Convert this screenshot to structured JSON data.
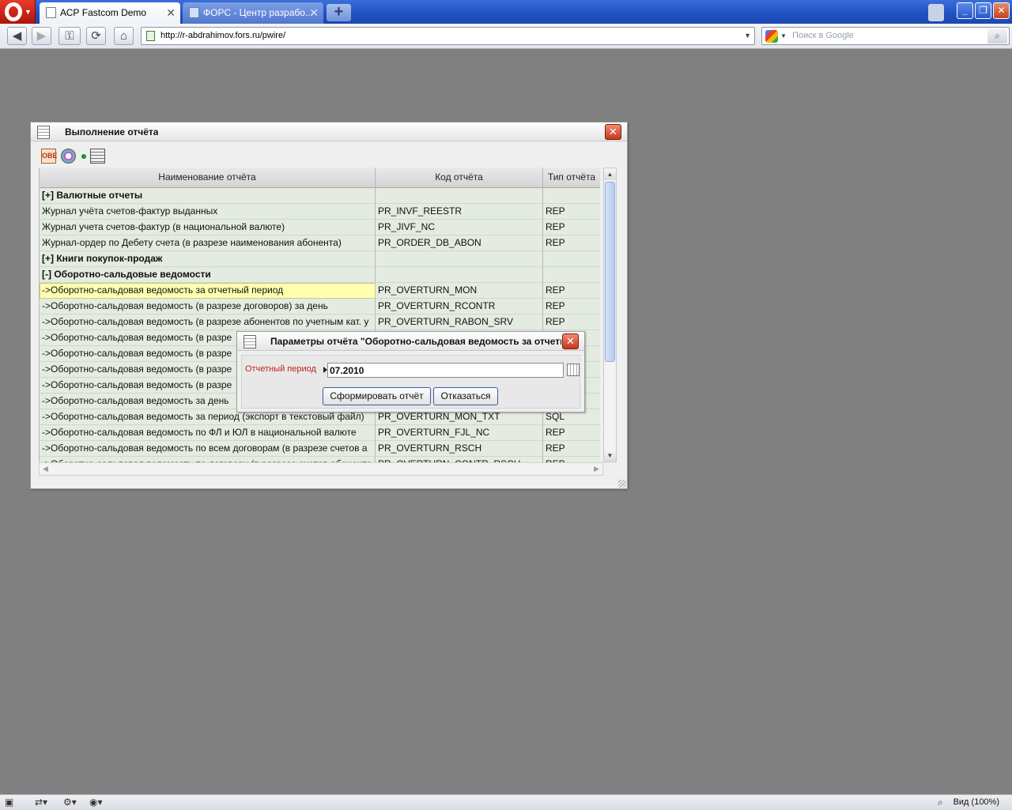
{
  "browser": {
    "tabs": [
      {
        "title": "АСР Fastcom Demo",
        "active": true
      },
      {
        "title": "ФОРС - Центр разрабо...",
        "active": false
      }
    ],
    "new_tab_label": "+",
    "close_glyph": "✕",
    "url": "http://r-abdrahimov.fors.ru/pwire/",
    "search_placeholder": "Поиск в Google",
    "status": {
      "zoom": "Вид (100%)"
    }
  },
  "report_window": {
    "title": "Выполнение отчёта",
    "toolbar": {
      "obe_label": "OBE"
    },
    "columns": [
      "Наименование отчёта",
      "Код отчёта",
      "Тип отчёта"
    ],
    "rows": [
      {
        "name": "[+] Валютные отчеты",
        "code": "",
        "type": "",
        "group": true
      },
      {
        "name": "Журнал учёта счетов-фактур выданных",
        "code": "PR_INVF_REESTR",
        "type": "REP"
      },
      {
        "name": "Журнал учета счетов-фактур (в национальной валюте)",
        "code": "PR_JIVF_NC",
        "type": "REP"
      },
      {
        "name": "Журнал-ордер по Дебету счета (в разрезе наименования абонента)",
        "code": "PR_ORDER_DB_ABON",
        "type": "REP"
      },
      {
        "name": "[+] Книги покупок-продаж",
        "code": "",
        "type": "",
        "group": true
      },
      {
        "name": "[-] Оборотно-сальдовые ведомости",
        "code": "",
        "type": "",
        "group": true
      },
      {
        "name": "->Оборотно-сальдовая ведомость за отчетный период",
        "code": "PR_OVERTURN_MON",
        "type": "REP",
        "selected": true
      },
      {
        "name": "->Оборотно-сальдовая ведомость (в разрезе договоров) за день",
        "code": "PR_OVERTURN_RCONTR",
        "type": "REP"
      },
      {
        "name": "->Оборотно-сальдовая ведомость (в разрезе абонентов по учетным кат. у",
        "code": "PR_OVERTURN_RABON_SRV",
        "type": "REP"
      },
      {
        "name": "->Оборотно-сальдовая ведомость (в разре",
        "code": "",
        "type": ""
      },
      {
        "name": "->Оборотно-сальдовая ведомость (в разре",
        "code": "",
        "type": ""
      },
      {
        "name": "->Оборотно-сальдовая ведомость (в разре",
        "code": "",
        "type": ""
      },
      {
        "name": "->Оборотно-сальдовая ведомость (в разре",
        "code": "",
        "type": ""
      },
      {
        "name": "->Оборотно-сальдовая ведомость за день",
        "code": "",
        "type": ""
      },
      {
        "name": "->Оборотно-сальдовая ведомость за период (экспорт в текстовый файл)",
        "code": "PR_OVERTURN_MON_TXT",
        "type": "SQL"
      },
      {
        "name": "->Оборотно-сальдовая ведомость по ФЛ и ЮЛ в национальной валюте",
        "code": "PR_OVERTURN_FJL_NC",
        "type": "REP"
      },
      {
        "name": "->Оборотно-сальдовая ведомость по всем договорам (в разрезе счетов а",
        "code": "PR_OVERTURN_RSCH",
        "type": "REP"
      },
      {
        "name": "->Оборотно-сальдовая ведомость по договору (в разрезе счетов абонента",
        "code": "PR_OVERTURN_CONTR_RSCH",
        "type": "REP"
      }
    ]
  },
  "params_dialog": {
    "title": "Параметры отчёта \"Оборотно-сальдовая ведомость за отчетный период\"",
    "period_label": "Отчетный период",
    "period_value": "07.2010",
    "submit_label": "Сформировать отчёт",
    "cancel_label": "Отказаться"
  }
}
